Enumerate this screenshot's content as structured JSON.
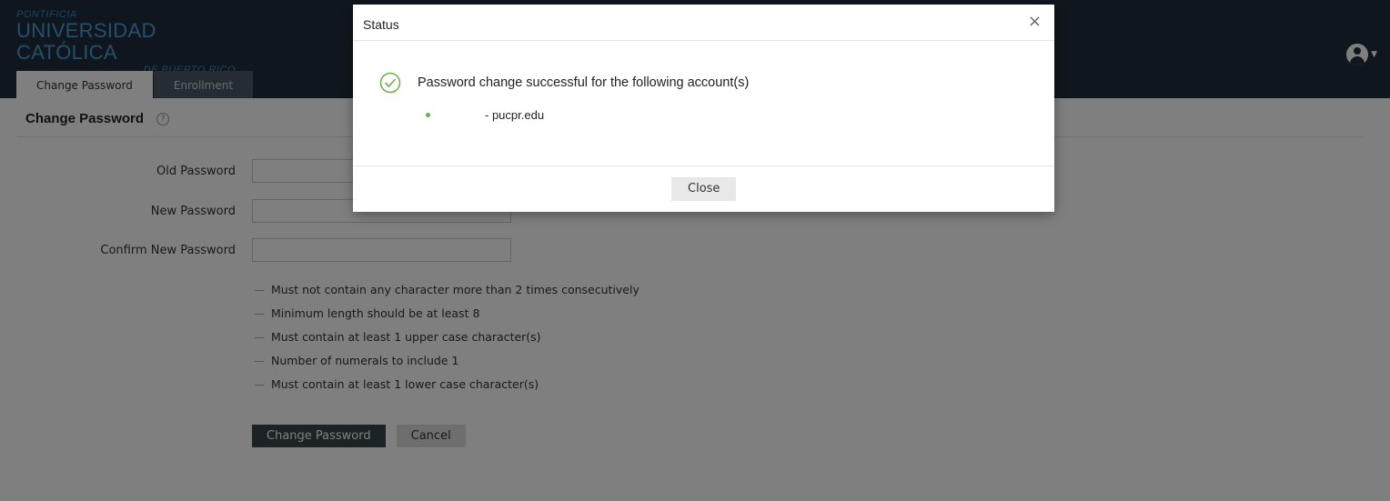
{
  "header": {
    "logo": {
      "line1": "PONTIFICIA",
      "line2": "UNIVERSIDAD CATÓLICA",
      "line3": "DE PUERTO RICO"
    },
    "tabs": [
      {
        "label": "Change Password",
        "active": true
      },
      {
        "label": "Enrollment",
        "active": false
      }
    ],
    "user_icon": "user-circle-icon"
  },
  "main": {
    "page_title": "Change Password",
    "help_icon": "?",
    "fields": {
      "old_password": {
        "label": "Old Password",
        "value": ""
      },
      "new_password": {
        "label": "New Password",
        "value": ""
      },
      "confirm_password": {
        "label": "Confirm New Password",
        "value": ""
      }
    },
    "rules": [
      "Must not contain any character more than 2 times consecutively",
      "Minimum length should be at least 8",
      "Must contain at least 1 upper case character(s)",
      "Number of numerals to include 1",
      "Must contain at least 1 lower case character(s)"
    ],
    "buttons": {
      "submit": "Change Password",
      "cancel": "Cancel"
    }
  },
  "modal": {
    "title": "Status",
    "close_symbol": "×",
    "message": "Password change successful for the following account(s)",
    "accounts": [
      "- pucpr.edu"
    ],
    "close_button": "Close",
    "accent_color": "#6ab04c"
  }
}
